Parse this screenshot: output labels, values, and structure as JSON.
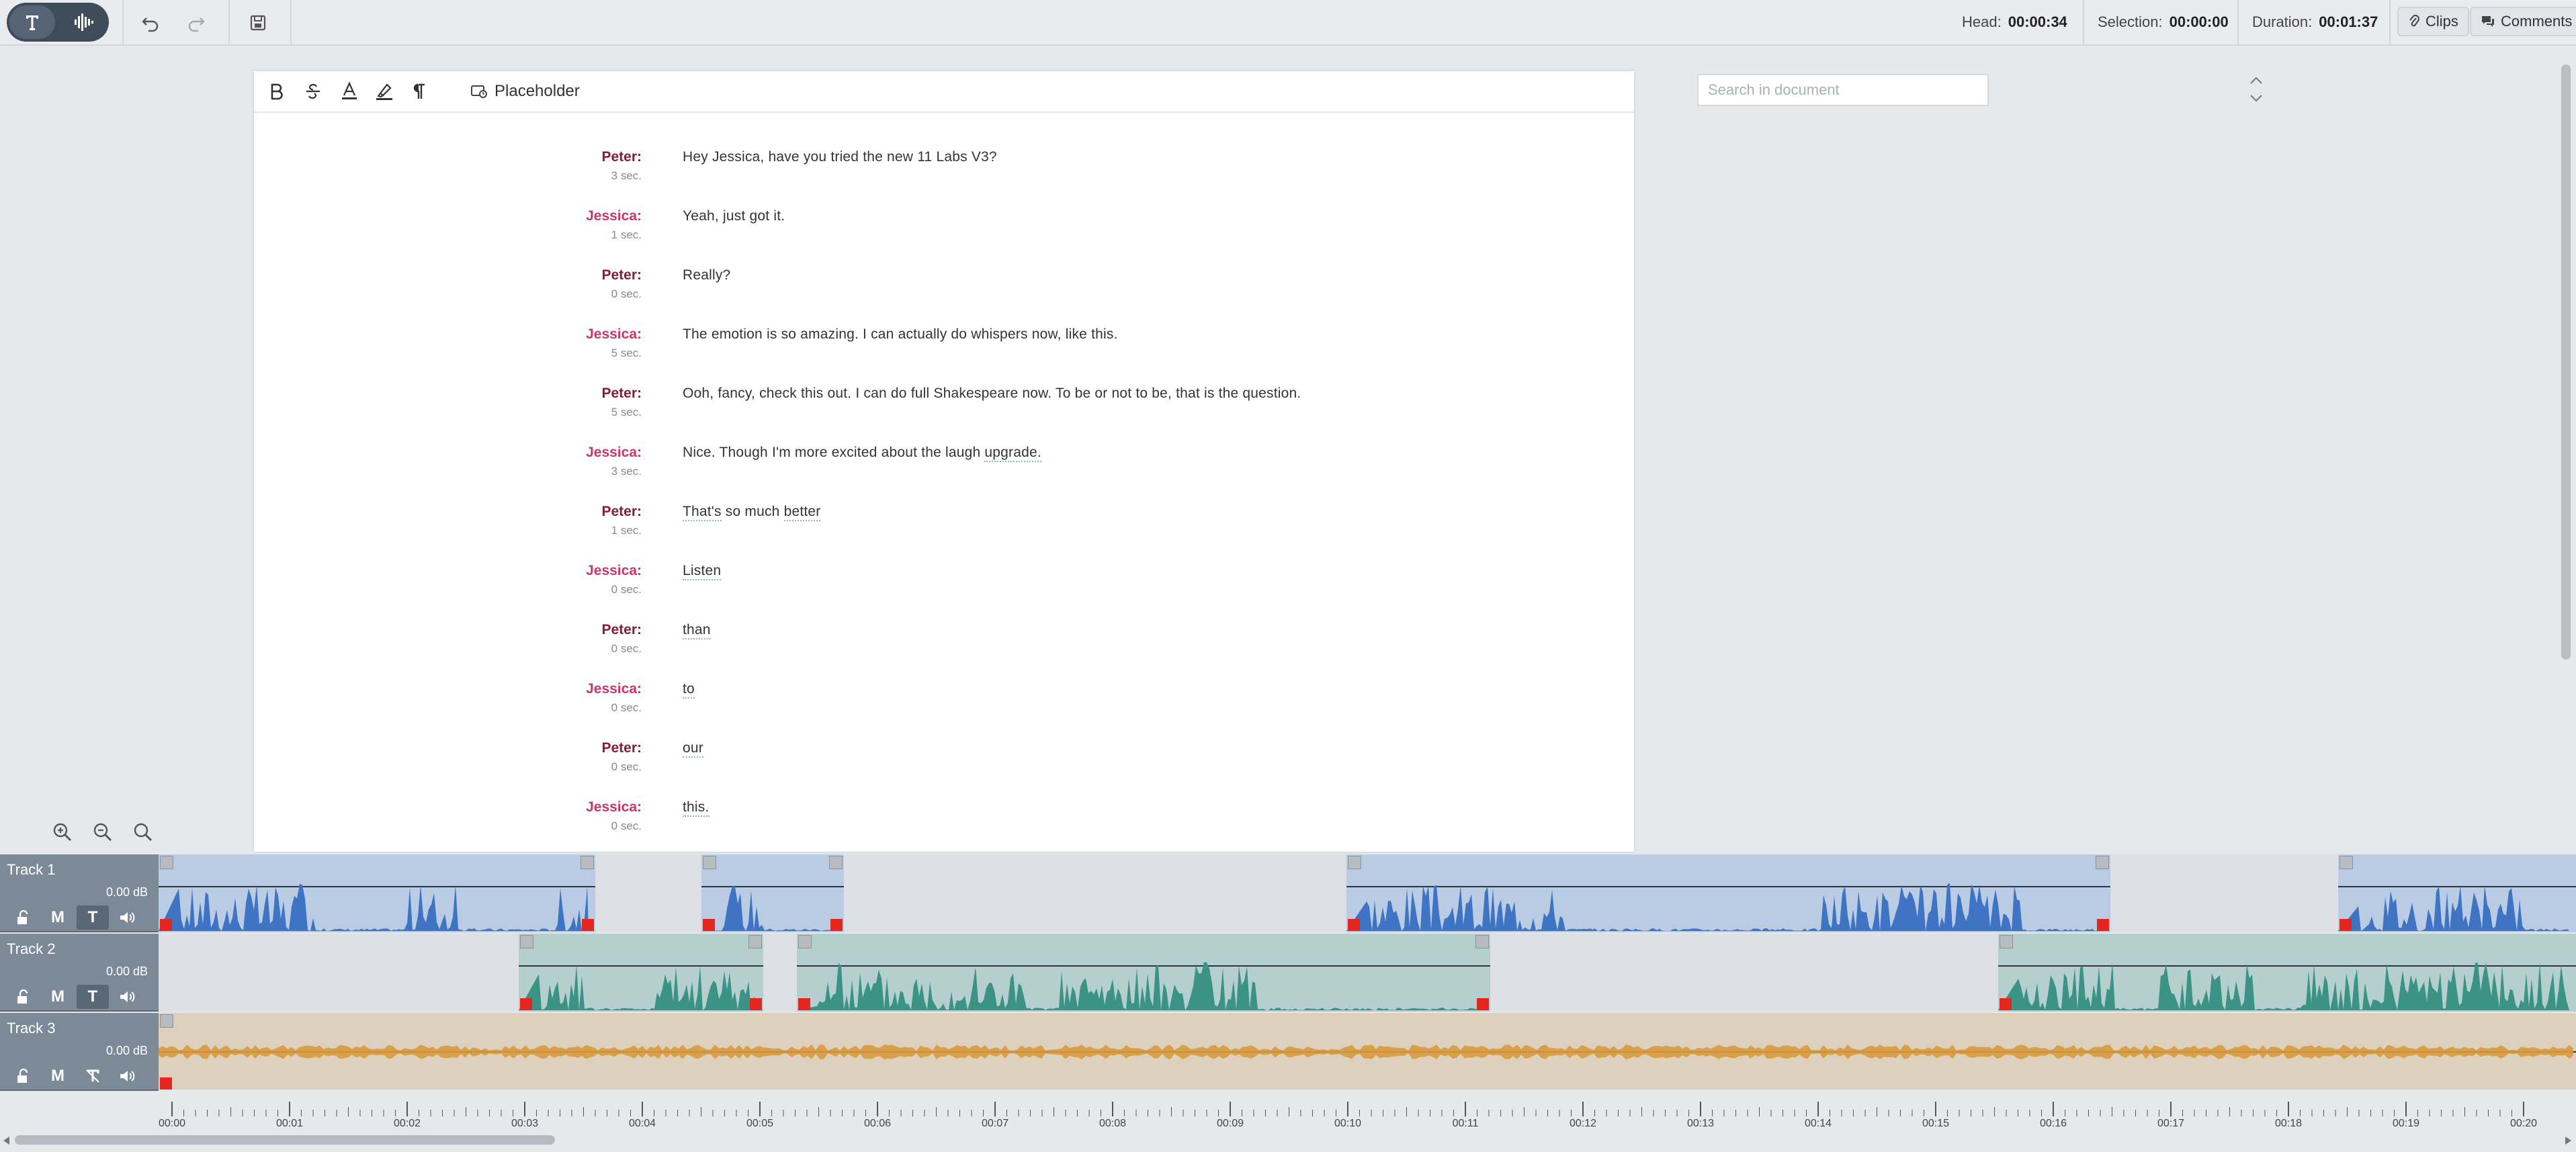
{
  "toolbar": {
    "mode_text_icon": "text-mode-icon",
    "mode_audio_icon": "waveform-icon",
    "undo_icon": "undo-icon",
    "redo_icon": "redo-icon",
    "save_icon": "save-icon"
  },
  "status": {
    "head_label": "Head:",
    "head_value": "00:00:34",
    "selection_label": "Selection:",
    "selection_value": "00:00:00",
    "duration_label": "Duration:",
    "duration_value": "00:01:37",
    "clips_label": "Clips",
    "comments_label": "Comments"
  },
  "editor": {
    "placeholder_label": "Placeholder",
    "search_placeholder": "Search in document",
    "turns": [
      {
        "speaker": "Peter:",
        "duration": "3 sec.",
        "text": "Hey Jessica, have you tried the new 11 Labs V3?"
      },
      {
        "speaker": "Jessica:",
        "duration": "1 sec.",
        "text": "Yeah, just got it."
      },
      {
        "speaker": "Peter:",
        "duration": "0 sec.",
        "text": "Really?"
      },
      {
        "speaker": "Jessica:",
        "duration": "5 sec.",
        "text": "The emotion is so amazing. I can actually do whispers now, like this."
      },
      {
        "speaker": "Peter:",
        "duration": "5 sec.",
        "text": "Ooh, fancy, check this out. I can do full Shakespeare now. To be or not to be, that is the question."
      },
      {
        "speaker": "Jessica:",
        "duration": "3 sec.",
        "text_before": "Nice. Though I'm more excited about the laugh ",
        "text_word": "upgrade."
      },
      {
        "speaker": "Peter:",
        "duration": "1 sec.",
        "w1": "That's",
        "mid": " so much ",
        "w2": "better"
      },
      {
        "speaker": "Jessica:",
        "duration": "0 sec.",
        "word": "Listen"
      },
      {
        "speaker": "Peter:",
        "duration": "0 sec.",
        "word": "than"
      },
      {
        "speaker": "Jessica:",
        "duration": "0 sec.",
        "word": "to"
      },
      {
        "speaker": "Peter:",
        "duration": "0 sec.",
        "word": "our"
      },
      {
        "speaker": "Jessica:",
        "duration": "0 sec.",
        "word": "this."
      }
    ]
  },
  "tracks": [
    {
      "name": "Track 1",
      "gain": "0.00 dB",
      "color": "#3f74c4",
      "clip_bg": "#b9cce4"
    },
    {
      "name": "Track 2",
      "gain": "0.00 dB",
      "color": "#3a9384",
      "clip_bg": "#b4cfcd"
    },
    {
      "name": "Track 3",
      "gain": "0.00 dB",
      "color": "#d89a3c",
      "clip_bg": "#ddd1bd"
    }
  ],
  "ruler": {
    "labels": [
      "00:00",
      "00:01",
      "00:02",
      "00:03",
      "00:04",
      "00:05",
      "00:06",
      "00:07",
      "00:08",
      "00:09",
      "00:10",
      "00:11",
      "00:12",
      "00:13",
      "00:14",
      "00:15",
      "00:16",
      "00:17",
      "00:18",
      "00:19",
      "00:20"
    ]
  }
}
